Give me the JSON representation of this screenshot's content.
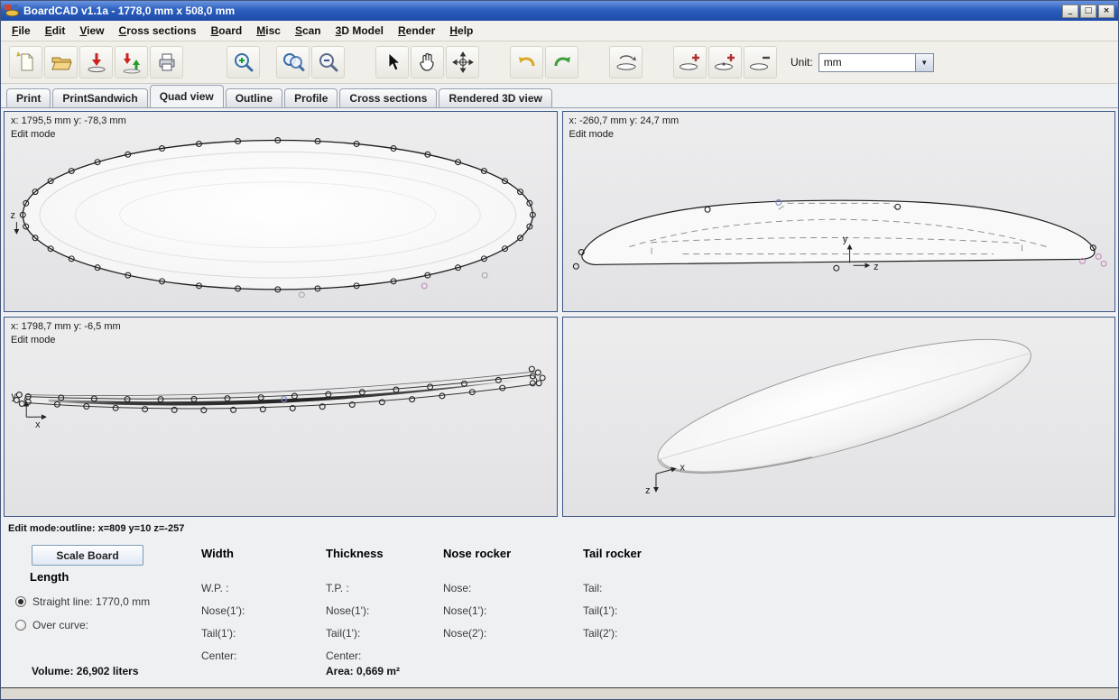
{
  "window": {
    "title": "BoardCAD v1.1a -   1778,0 mm x 508,0 mm",
    "controls": {
      "minimize": "_",
      "maximize": "□",
      "close": "×"
    }
  },
  "menu": {
    "items": [
      "File",
      "Edit",
      "View",
      "Cross sections",
      "Board",
      "Misc",
      "Scan",
      "3D Model",
      "Render",
      "Help"
    ]
  },
  "toolbar": {
    "unit_label": "Unit:",
    "unit_value": "mm",
    "icons": [
      "new-document",
      "open-folder",
      "save",
      "save-as",
      "print",
      "zoom-in",
      "zoom-previous",
      "zoom-out",
      "select-pointer",
      "pan-hand",
      "rotate-view",
      "undo",
      "redo",
      "flip-board",
      "add-control-point",
      "add-guide-point",
      "remove-control-point"
    ]
  },
  "tabs": {
    "items": [
      "Print",
      "PrintSandwich",
      "Quad view",
      "Outline",
      "Profile",
      "Cross sections",
      "Rendered 3D view"
    ],
    "selected": "Quad view"
  },
  "viewports": {
    "outline": {
      "coords": "x: 1795,5 mm  y: -78,3 mm",
      "mode": "Edit mode",
      "axis": "z"
    },
    "cross_section": {
      "coords": "x: -260,7 mm   y: 24,7 mm",
      "mode": "Edit mode",
      "axis_vertical": "y",
      "axis_horizontal": "z"
    },
    "profile": {
      "coords": "x: 1798,7 mm  y: -6,5 mm",
      "mode": "Edit mode",
      "axis_vertical": "y",
      "axis_horizontal": "x"
    },
    "rendered": {
      "axis_vertical": "z",
      "axis_horizontal": "x"
    }
  },
  "status_line": "Edit mode:outline: x=809 y=10 z=-257",
  "panel": {
    "scale_button": "Scale Board",
    "length": {
      "header": "Length",
      "options": [
        {
          "label": "Straight line: 1770,0 mm",
          "selected": true
        },
        {
          "label": "Over curve:",
          "selected": false
        }
      ]
    },
    "columns": [
      {
        "header": "Width",
        "rows": [
          "W.P. :",
          "Nose(1'):",
          "Tail(1'):",
          "Center:"
        ]
      },
      {
        "header": "Thickness",
        "rows": [
          "T.P. :",
          "Nose(1'):",
          "Tail(1'):",
          "Center:"
        ]
      },
      {
        "header": "Nose rocker",
        "rows": [
          "Nose:",
          "Nose(1'):",
          "Nose(2'):"
        ]
      },
      {
        "header": "Tail rocker",
        "rows": [
          "Tail:",
          "Tail(1'):",
          "Tail(2'):"
        ]
      }
    ],
    "volume": "Volume: 26,902 liters",
    "area": "Area: 0,669 m²"
  }
}
